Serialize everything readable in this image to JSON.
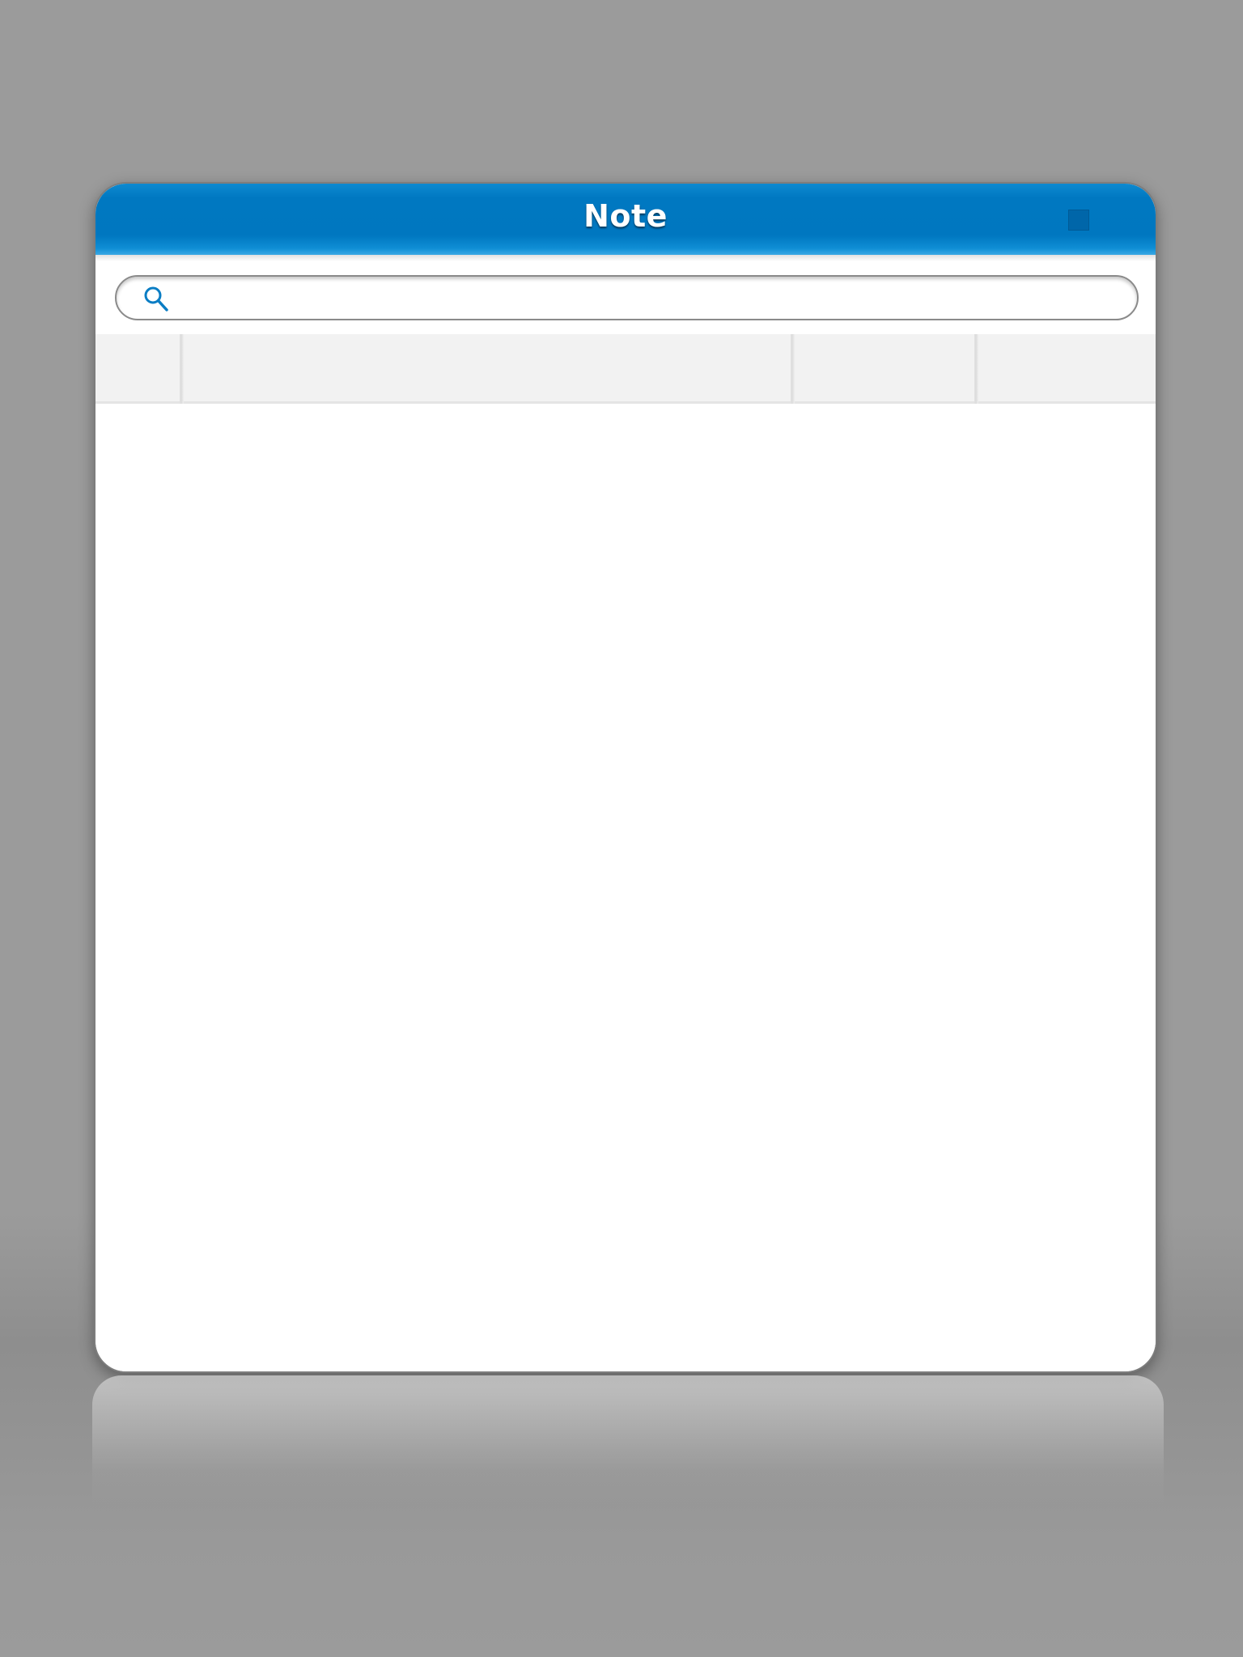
{
  "window": {
    "title": "Note"
  },
  "search": {
    "value": "",
    "placeholder": "",
    "icon": "search-icon"
  },
  "table": {
    "columns": [
      "",
      "",
      "",
      ""
    ],
    "rows": []
  },
  "colors": {
    "title_bar": "#0077c0",
    "accent": "#0077c0",
    "background": "#9b9b9b",
    "header_row": "#f2f2f2"
  }
}
